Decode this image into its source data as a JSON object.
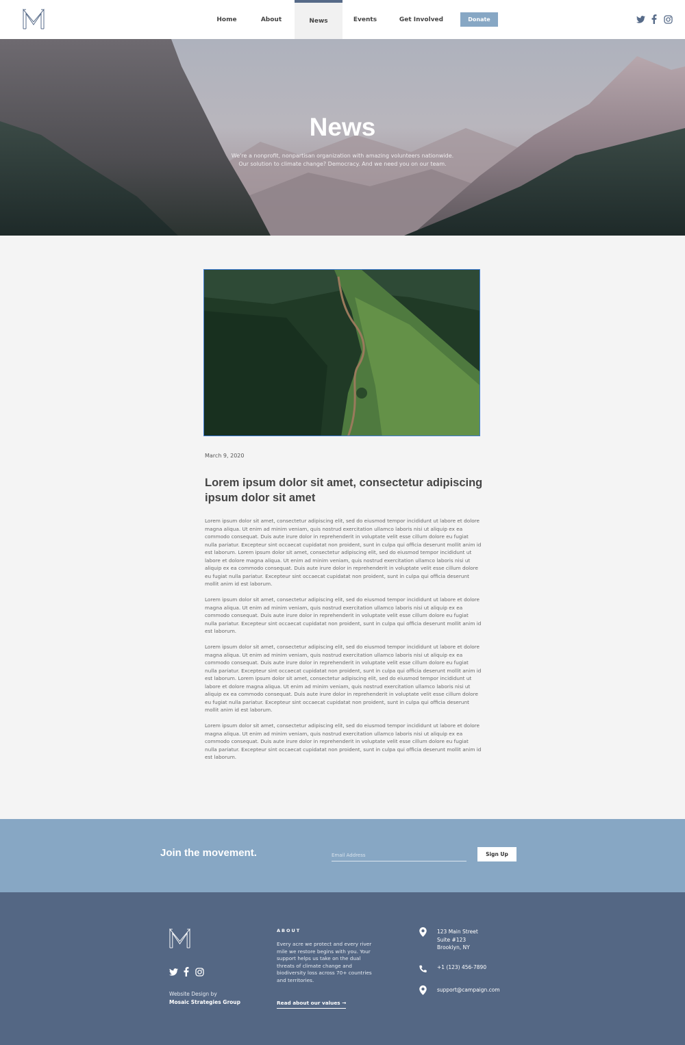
{
  "nav": {
    "items": [
      {
        "label": "Home"
      },
      {
        "label": "About"
      },
      {
        "label": "News"
      },
      {
        "label": "Events"
      },
      {
        "label": "Get Involved"
      }
    ],
    "active": "News",
    "donate_label": "Donate"
  },
  "social": {
    "icons": [
      "twitter-icon",
      "facebook-icon",
      "instagram-icon"
    ]
  },
  "hero": {
    "title": "News",
    "subtitle": "We're a nonprofit, nonpartisan organization with amazing volunteers nationwide. Our solution to climate change? Democracy. And we need you on our team."
  },
  "article": {
    "date": "March 9, 2020",
    "headline": "Lorem ipsum dolor sit amet, consectetur adipiscing ipsum dolor sit amet",
    "paragraphs": [
      "Lorem ipsum dolor sit amet, consectetur adipiscing elit, sed do eiusmod tempor incididunt ut labore et dolore magna aliqua. Ut enim ad minim veniam, quis nostrud exercitation ullamco laboris nisi ut aliquip ex ea commodo consequat. Duis aute irure dolor in reprehenderit in voluptate velit esse cillum dolore eu fugiat nulla pariatur. Excepteur sint occaecat cupidatat non proident, sunt in culpa qui officia deserunt mollit anim id est laborum. Lorem ipsum dolor sit amet, consectetur adipiscing elit, sed do eiusmod tempor incididunt ut labore et dolore magna aliqua. Ut enim ad minim veniam, quis nostrud exercitation ullamco laboris nisi ut aliquip ex ea commodo consequat. Duis aute irure dolor in reprehenderit in voluptate velit esse cillum dolore eu fugiat nulla pariatur. Excepteur sint occaecat cupidatat non proident, sunt in culpa qui officia deserunt mollit anim id est laborum.",
      "Lorem ipsum dolor sit amet, consectetur adipiscing elit, sed do eiusmod tempor incididunt ut labore et dolore magna aliqua. Ut enim ad minim veniam, quis nostrud exercitation ullamco laboris nisi ut aliquip ex ea commodo consequat. Duis aute irure dolor in reprehenderit in voluptate velit esse cillum dolore eu fugiat nulla pariatur. Excepteur sint occaecat cupidatat non proident, sunt in culpa qui officia deserunt mollit anim id est laborum.",
      "Lorem ipsum dolor sit amet, consectetur adipiscing elit, sed do eiusmod tempor incididunt ut labore et dolore magna aliqua. Ut enim ad minim veniam, quis nostrud exercitation ullamco laboris nisi ut aliquip ex ea commodo consequat. Duis aute irure dolor in reprehenderit in voluptate velit esse cillum dolore eu fugiat nulla pariatur. Excepteur sint occaecat cupidatat non proident, sunt in culpa qui officia deserunt mollit anim id est laborum. Lorem ipsum dolor sit amet, consectetur adipiscing elit, sed do eiusmod tempor incididunt ut labore et dolore magna aliqua. Ut enim ad minim veniam, quis nostrud exercitation ullamco laboris nisi ut aliquip ex ea commodo consequat. Duis aute irure dolor in reprehenderit in voluptate velit esse cillum dolore eu fugiat nulla pariatur. Excepteur sint occaecat cupidatat non proident, sunt in culpa qui officia deserunt mollit anim id est laborum.",
      "Lorem ipsum dolor sit amet, consectetur adipiscing elit, sed do eiusmod tempor incididunt ut labore et dolore magna aliqua. Ut enim ad minim veniam, quis nostrud exercitation ullamco laboris nisi ut aliquip ex ea commodo consequat. Duis aute irure dolor in reprehenderit in voluptate velit esse cillum dolore eu fugiat nulla pariatur. Excepteur sint occaecat cupidatat non proident, sunt in culpa qui officia deserunt mollit anim id est laborum."
    ]
  },
  "join": {
    "title": "Join the movement.",
    "email_placeholder": "Email Address",
    "email_value": "",
    "signup_label": "Sign Up"
  },
  "footer": {
    "credit_line1": "Website Design by",
    "credit_line2": "Mosaic Strategies Group",
    "about_heading": "ABOUT",
    "about_text": "Every acre we protect and every river mile we restore begins with you. Your support helps us take on the dual threats of climate change and biodiversity loss across 70+ countries and territories.",
    "about_link": "Read about our values →",
    "address": [
      "123 Main Street",
      "Suite #123",
      "Brooklyn, NY"
    ],
    "phone": "+1 (123) 456-7890",
    "email": "support@campaign.com"
  },
  "colors": {
    "accent": "#566a88",
    "donate": "#87a7c4",
    "join_band": "#87a7c4",
    "footer": "#546784",
    "page_bg": "#f4f4f4",
    "image_border": "#3b7bd4"
  }
}
